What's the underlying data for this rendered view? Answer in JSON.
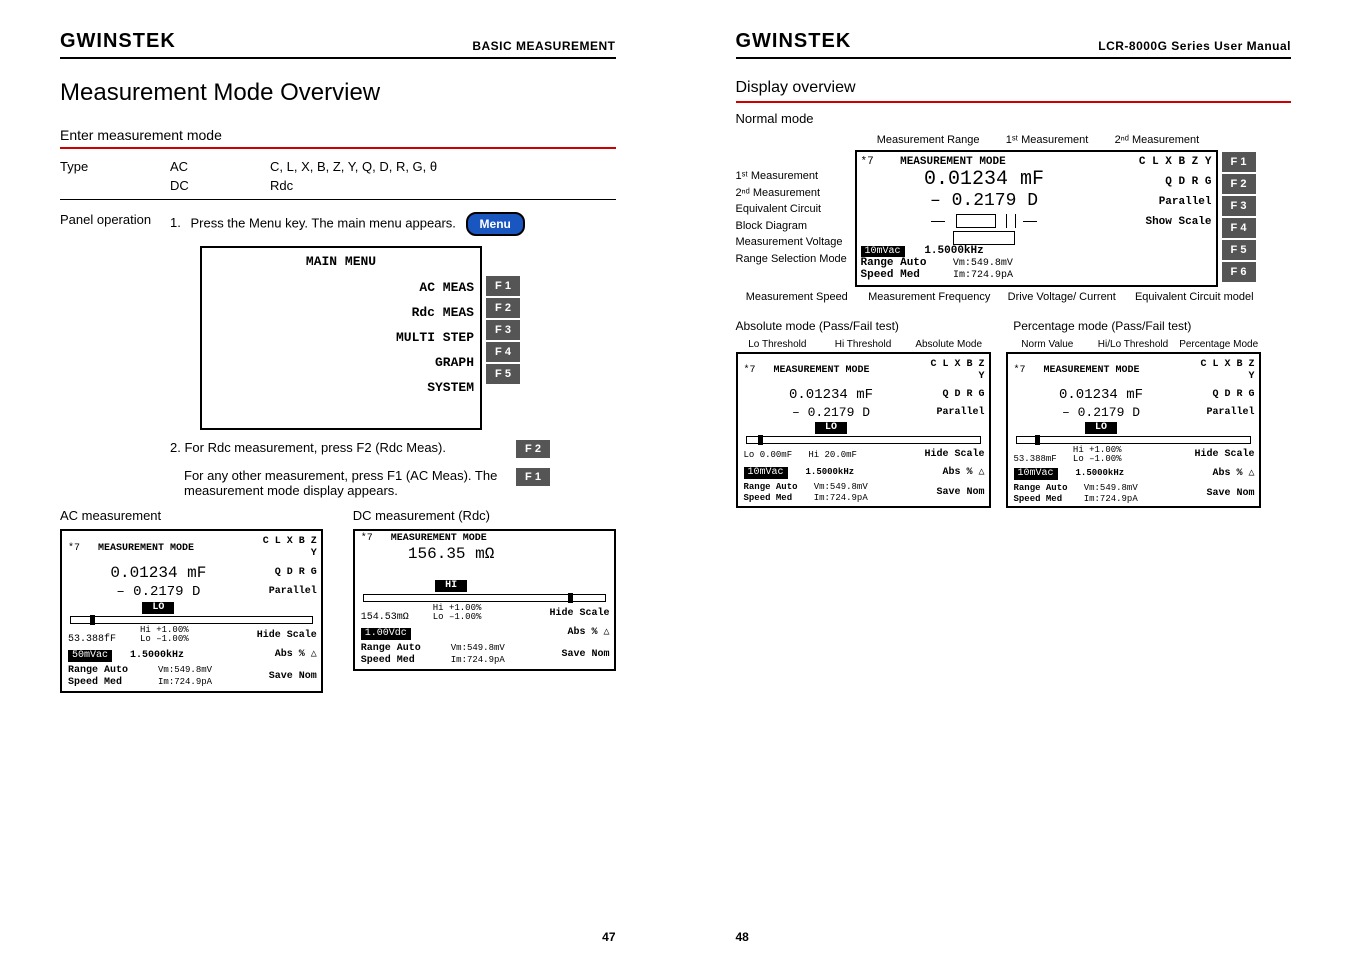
{
  "brand": "GWINSTEK",
  "left_header": "BASIC MEASUREMENT",
  "right_header": "LCR-8000G Series User Manual",
  "page_left_num": "47",
  "page_right_num": "48",
  "left_page": {
    "title": "Measurement Mode Overview",
    "enter_mode_heading": "Enter measurement mode",
    "type_label": "Type",
    "type_rows": [
      {
        "col2": "AC",
        "col3": "C, L, X, B, Z, Y, Q, D, R, G, θ"
      },
      {
        "col2": "DC",
        "col3": "Rdc"
      }
    ],
    "panel_op_label": "Panel operation",
    "step1_text_a": "1.",
    "step1_text_b": "Press the Menu key. The main menu appears.",
    "menu_btn": "Menu",
    "main_menu_title": "MAIN MENU",
    "main_menu_items": [
      {
        "label": "AC MEAS",
        "f": "F 1"
      },
      {
        "label": "Rdc MEAS",
        "f": "F 2"
      },
      {
        "label": "MULTI STEP",
        "f": "F 3"
      },
      {
        "label": "GRAPH",
        "f": "F 4"
      },
      {
        "label": "SYSTEM",
        "f": "F 5"
      }
    ],
    "step2a": "2.",
    "step2a_text": "For Rdc measurement, press F2 (Rdc Meas).",
    "step2a_f": "F 2",
    "step2b_text": "For any other measurement, press F1 (AC Meas). The measurement mode display appears.",
    "step2b_f": "F 1",
    "ac_label": "AC measurement",
    "dc_label": "DC measurement (Rdc)"
  },
  "lcd_ac": {
    "header_left": "*7",
    "header_center": "MEASUREMENT MODE",
    "side1": "C L X B Z Y",
    "reading1": "0.01234 mF",
    "side2": "Q D R G",
    "reading2": "– 0.2179   D",
    "badge": "LO",
    "side3": "Parallel",
    "side4": "Hide Scale",
    "row_thresh_left": "53.388fF",
    "row_thresh_hi": "Hi +1.00%",
    "row_thresh_lo": "Lo –1.00%",
    "side5": "Abs % △",
    "vac": "50mVac",
    "freq": "1.5000kHz",
    "range": "Range Auto",
    "speed": "Speed Med",
    "vm": "Vm:549.8mV",
    "im": "Im:724.9pA",
    "side6": "Save Nom"
  },
  "lcd_dc": {
    "header_left": "*7",
    "header_center": "MEASUREMENT MODE",
    "reading1": "156.35 mΩ",
    "badge": "HI",
    "side4": "Hide Scale",
    "row_thresh_left": "154.53mΩ",
    "row_thresh_hi": "Hi +1.00%",
    "row_thresh_lo": "Lo –1.00%",
    "side5": "Abs % △",
    "vac": "1.00Vdc",
    "range": "Range Auto",
    "speed": "Speed Med",
    "vm": "Vm:549.8mV",
    "im": "Im:724.9pA",
    "side6": "Save Nom"
  },
  "right_page": {
    "title": "Display overview",
    "normal_mode": "Normal mode",
    "ov_labels": {
      "meas_range": "Measurement Range",
      "first_meas_top": "1ˢᵗ Measurement",
      "second_meas_top": "2ⁿᵈ Measurement",
      "first_meas": "1ˢᵗ Measurement",
      "second_meas": "2ⁿᵈ Measurement",
      "eq_circuit": "Equivalent Circuit Block Diagram",
      "meas_voltage": "Measurement Voltage",
      "range_sel": "Range Selection Mode",
      "meas_speed": "Measurement Speed",
      "meas_freq": "Measurement Frequency",
      "drive_vi": "Drive Voltage/ Current",
      "eq_model": "Equivalent Circuit model"
    },
    "ov_screen": {
      "header_left": "*7",
      "header_center": "MEASUREMENT MODE",
      "r1": "0.01234 mF",
      "r2": "– 0.2179   D",
      "vac": "10mVac",
      "freq": "1.5000kHz",
      "range": "Range Auto",
      "speed": "Speed Med",
      "vm": "Vm:549.8mV",
      "im": "Im:724.9pA",
      "side1": "C L X B Z Y",
      "side2": "Q D R G",
      "side3": "Parallel",
      "side4": "Show Scale",
      "f1": "F 1",
      "f2": "F 2",
      "f3": "F 3",
      "f4": "F 4",
      "f5": "F 5",
      "f6": "F 6"
    },
    "abs_mode_label": "Absolute mode (Pass/Fail test)",
    "pct_mode_label": "Percentage mode (Pass/Fail test)",
    "abs_fields": {
      "a": "Lo Threshold",
      "b": "Hi Threshold",
      "c": "Absolute Mode"
    },
    "pct_fields": {
      "a": "Norm Value",
      "b": "Hi/Lo Threshold",
      "c": "Percentage Mode"
    },
    "lcd_abs": {
      "header_left": "*7",
      "header_center": "MEASUREMENT MODE",
      "side1": "C L X B Z Y",
      "reading1": "0.01234 mF",
      "side2": "Q D R G",
      "reading2": "– 0.2179   D",
      "badge": "LO",
      "side3": "Parallel",
      "scale_label_lo": "Lo 0.00mF",
      "scale_label_hi": "Hi 20.0mF",
      "side4": "Hide Scale",
      "side5": "Abs % △",
      "vac": "10mVac",
      "freq": "1.5000kHz",
      "range": "Range Auto",
      "speed": "Speed Med",
      "vm": "Vm:549.8mV",
      "im": "Im:724.9pA",
      "side6": "Save Nom"
    },
    "lcd_pct": {
      "header_left": "*7",
      "header_center": "MEASUREMENT MODE",
      "side1": "C L X B Z Y",
      "reading1": "0.01234 mF",
      "side2": "Q D R G",
      "reading2": "– 0.2179   D",
      "badge": "LO",
      "side3": "Parallel",
      "norm": "53.388mF",
      "hi": "Hi +1.00%",
      "lo": "Lo –1.00%",
      "side4": "Hide Scale",
      "side5": "Abs % △",
      "vac": "10mVac",
      "freq": "1.5000kHz",
      "range": "Range Auto",
      "speed": "Speed Med",
      "vm": "Vm:549.8mV",
      "im": "Im:724.9pA",
      "side6": "Save Nom"
    }
  }
}
